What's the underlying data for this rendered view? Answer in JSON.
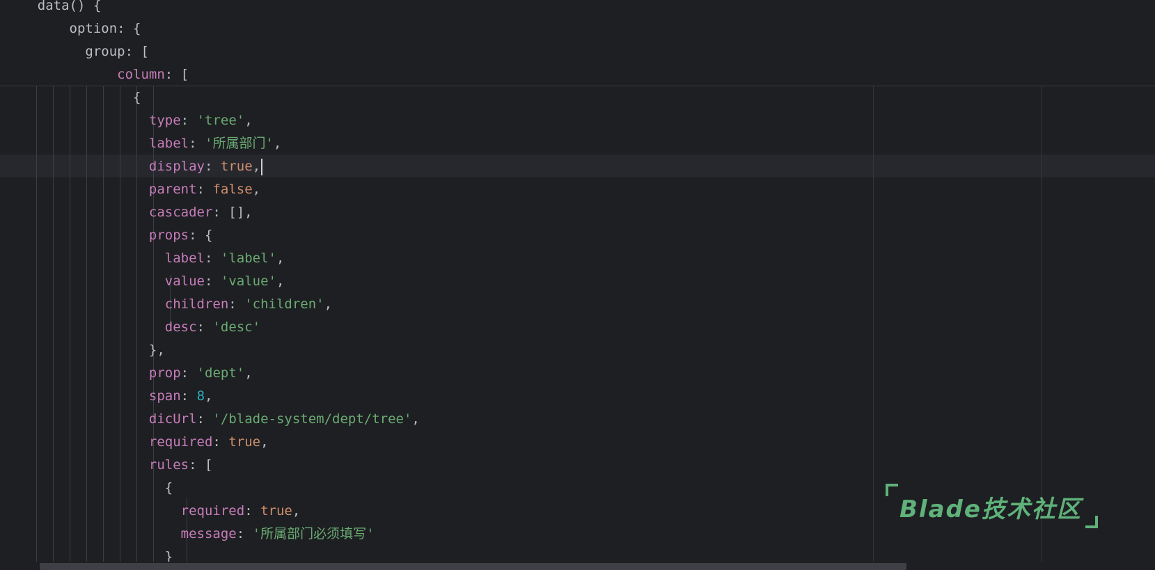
{
  "editor": {
    "caret_line": 7,
    "lines": [
      {
        "indent": "    ",
        "parts": [
          {
            "t": "plain",
            "v": "data() {"
          }
        ]
      },
      {
        "indent": "        ",
        "parts": [
          {
            "t": "plain",
            "v": "option: {"
          }
        ]
      },
      {
        "indent": "          ",
        "parts": [
          {
            "t": "plain",
            "v": "group: ["
          }
        ]
      },
      {
        "indent": "              ",
        "parts": [
          {
            "t": "key",
            "v": "column"
          },
          {
            "t": "plain",
            "v": ": ["
          }
        ]
      },
      {
        "indent": "                ",
        "parts": [
          {
            "t": "plain",
            "v": "{"
          }
        ]
      },
      {
        "indent": "                  ",
        "parts": [
          {
            "t": "key",
            "v": "type"
          },
          {
            "t": "plain",
            "v": ": "
          },
          {
            "t": "str",
            "v": "'tree'"
          },
          {
            "t": "plain",
            "v": ","
          }
        ]
      },
      {
        "indent": "                  ",
        "parts": [
          {
            "t": "key",
            "v": "label"
          },
          {
            "t": "plain",
            "v": ": "
          },
          {
            "t": "str",
            "v": "'所属部门'"
          },
          {
            "t": "plain",
            "v": ","
          }
        ]
      },
      {
        "indent": "                  ",
        "parts": [
          {
            "t": "key",
            "v": "display"
          },
          {
            "t": "plain",
            "v": ": "
          },
          {
            "t": "kw",
            "v": "true"
          },
          {
            "t": "plain",
            "v": ","
          }
        ]
      },
      {
        "indent": "                  ",
        "parts": [
          {
            "t": "key",
            "v": "parent"
          },
          {
            "t": "plain",
            "v": ": "
          },
          {
            "t": "kw",
            "v": "false"
          },
          {
            "t": "plain",
            "v": ","
          }
        ]
      },
      {
        "indent": "                  ",
        "parts": [
          {
            "t": "key",
            "v": "cascader"
          },
          {
            "t": "plain",
            "v": ": [],"
          }
        ]
      },
      {
        "indent": "                  ",
        "parts": [
          {
            "t": "key",
            "v": "props"
          },
          {
            "t": "plain",
            "v": ": {"
          }
        ]
      },
      {
        "indent": "                    ",
        "parts": [
          {
            "t": "key",
            "v": "label"
          },
          {
            "t": "plain",
            "v": ": "
          },
          {
            "t": "str",
            "v": "'label'"
          },
          {
            "t": "plain",
            "v": ","
          }
        ]
      },
      {
        "indent": "                    ",
        "parts": [
          {
            "t": "key",
            "v": "value"
          },
          {
            "t": "plain",
            "v": ": "
          },
          {
            "t": "str",
            "v": "'value'"
          },
          {
            "t": "plain",
            "v": ","
          }
        ]
      },
      {
        "indent": "                    ",
        "parts": [
          {
            "t": "key",
            "v": "children"
          },
          {
            "t": "plain",
            "v": ": "
          },
          {
            "t": "str",
            "v": "'children'"
          },
          {
            "t": "plain",
            "v": ","
          }
        ]
      },
      {
        "indent": "                    ",
        "parts": [
          {
            "t": "key",
            "v": "desc"
          },
          {
            "t": "plain",
            "v": ": "
          },
          {
            "t": "str",
            "v": "'desc'"
          }
        ]
      },
      {
        "indent": "                  ",
        "parts": [
          {
            "t": "plain",
            "v": "},"
          }
        ]
      },
      {
        "indent": "                  ",
        "parts": [
          {
            "t": "key",
            "v": "prop"
          },
          {
            "t": "plain",
            "v": ": "
          },
          {
            "t": "str",
            "v": "'dept'"
          },
          {
            "t": "plain",
            "v": ","
          }
        ]
      },
      {
        "indent": "                  ",
        "parts": [
          {
            "t": "key",
            "v": "span"
          },
          {
            "t": "plain",
            "v": ": "
          },
          {
            "t": "num",
            "v": "8"
          },
          {
            "t": "plain",
            "v": ","
          }
        ]
      },
      {
        "indent": "                  ",
        "parts": [
          {
            "t": "key",
            "v": "dicUrl"
          },
          {
            "t": "plain",
            "v": ": "
          },
          {
            "t": "str",
            "v": "'/blade-system/dept/tree'"
          },
          {
            "t": "plain",
            "v": ","
          }
        ]
      },
      {
        "indent": "                  ",
        "parts": [
          {
            "t": "key",
            "v": "required"
          },
          {
            "t": "plain",
            "v": ": "
          },
          {
            "t": "kw",
            "v": "true"
          },
          {
            "t": "plain",
            "v": ","
          }
        ]
      },
      {
        "indent": "                  ",
        "parts": [
          {
            "t": "key",
            "v": "rules"
          },
          {
            "t": "plain",
            "v": ": ["
          }
        ]
      },
      {
        "indent": "                    ",
        "parts": [
          {
            "t": "plain",
            "v": "{"
          }
        ]
      },
      {
        "indent": "                      ",
        "parts": [
          {
            "t": "key",
            "v": "required"
          },
          {
            "t": "plain",
            "v": ": "
          },
          {
            "t": "kw",
            "v": "true"
          },
          {
            "t": "plain",
            "v": ","
          }
        ]
      },
      {
        "indent": "                      ",
        "parts": [
          {
            "t": "key",
            "v": "message"
          },
          {
            "t": "plain",
            "v": ": "
          },
          {
            "t": "str",
            "v": "'所属部门必须填写'"
          }
        ]
      },
      {
        "indent": "                    ",
        "parts": [
          {
            "t": "plain",
            "v": "}"
          }
        ]
      }
    ]
  },
  "watermark": {
    "text": "Blade技术社区"
  },
  "colors": {
    "background": "#1e1f22",
    "key": "#c77dbb",
    "string": "#6aab73",
    "keyword": "#cf8e6d",
    "number": "#2aacb8",
    "watermark": "#5fb27a"
  }
}
